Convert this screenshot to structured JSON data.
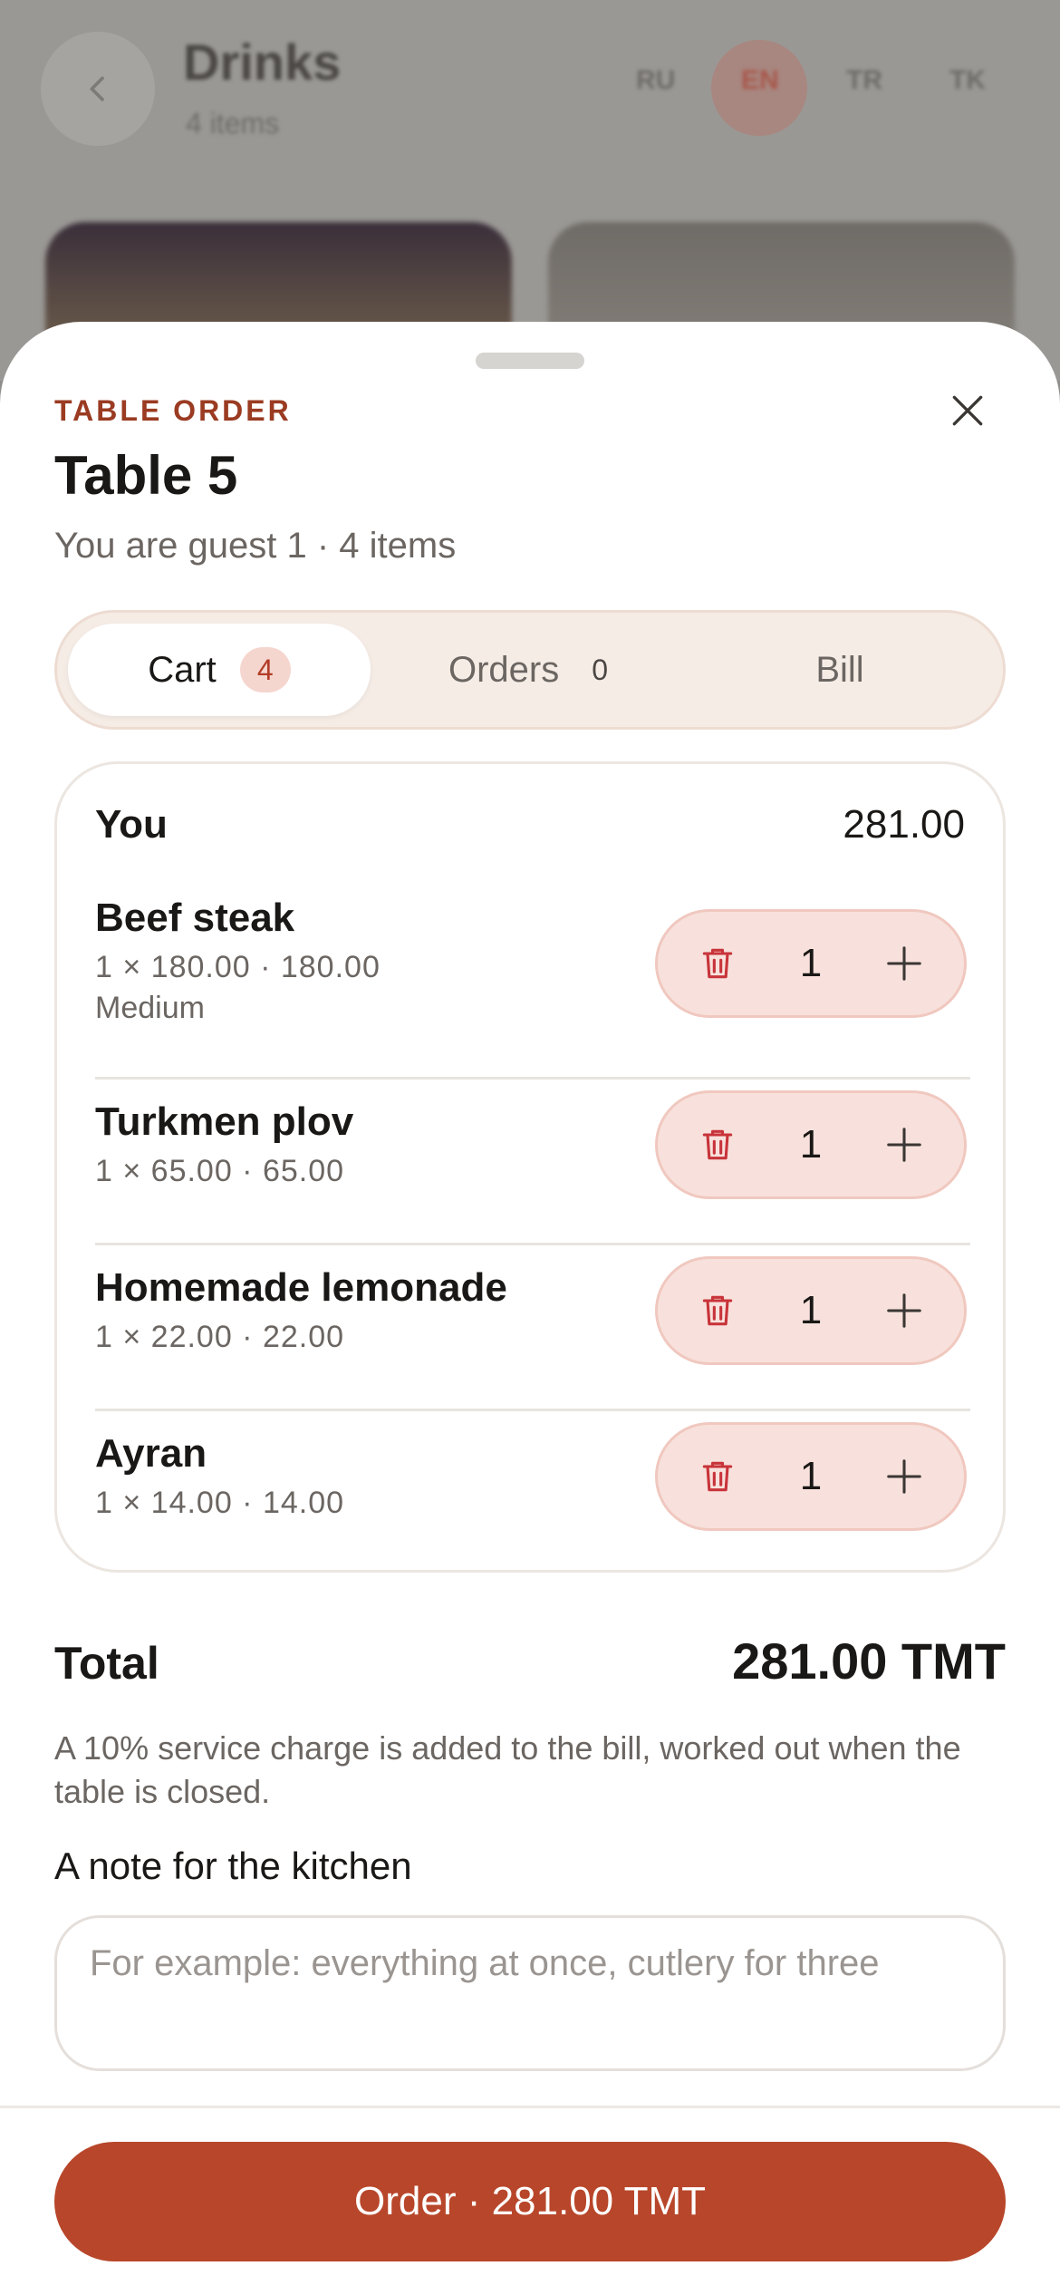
{
  "background": {
    "title": "Drinks",
    "subtitle": "4 items",
    "languages": [
      "RU",
      "EN",
      "TR",
      "TK"
    ],
    "active_language": "EN"
  },
  "sheet": {
    "eyebrow": "TABLE ORDER",
    "title": "Table 5",
    "subtitle": "You are guest 1 · 4 items"
  },
  "tabs": [
    {
      "label": "Cart",
      "badge": "4",
      "active": true
    },
    {
      "label": "Orders",
      "count": "0",
      "active": false
    },
    {
      "label": "Bill",
      "active": false
    }
  ],
  "cart": {
    "owner": "You",
    "owner_amount": "281.00",
    "items": [
      {
        "name": "Beef steak",
        "price": "1 × 180.00 · 180.00",
        "modifier": "Medium",
        "qty": "1"
      },
      {
        "name": "Turkmen plov",
        "price": "1 × 65.00 · 65.00",
        "modifier": "",
        "qty": "1"
      },
      {
        "name": "Homemade lemonade",
        "price": "1 × 22.00 · 22.00",
        "modifier": "",
        "qty": "1"
      },
      {
        "name": "Ayran",
        "price": "1 × 14.00 · 14.00",
        "modifier": "",
        "qty": "1"
      }
    ]
  },
  "total": {
    "label": "Total",
    "value": "281.00 TMT",
    "service_note": "A 10% service charge is added to the bill, worked out when the table is closed."
  },
  "kitchen_note": {
    "label": "A note for the kitchen",
    "placeholder": "For example: everything at once, cutlery for three"
  },
  "order_button": {
    "label": "Order · 281.00 TMT"
  },
  "colors": {
    "accent": "#b8462a",
    "accent_soft": "#f8e1dc",
    "eyebrow": "#9a3b22"
  },
  "icons": {
    "close": "close-icon",
    "delete": "trash-icon",
    "increment": "plus-icon",
    "back": "chevron-left-icon"
  }
}
